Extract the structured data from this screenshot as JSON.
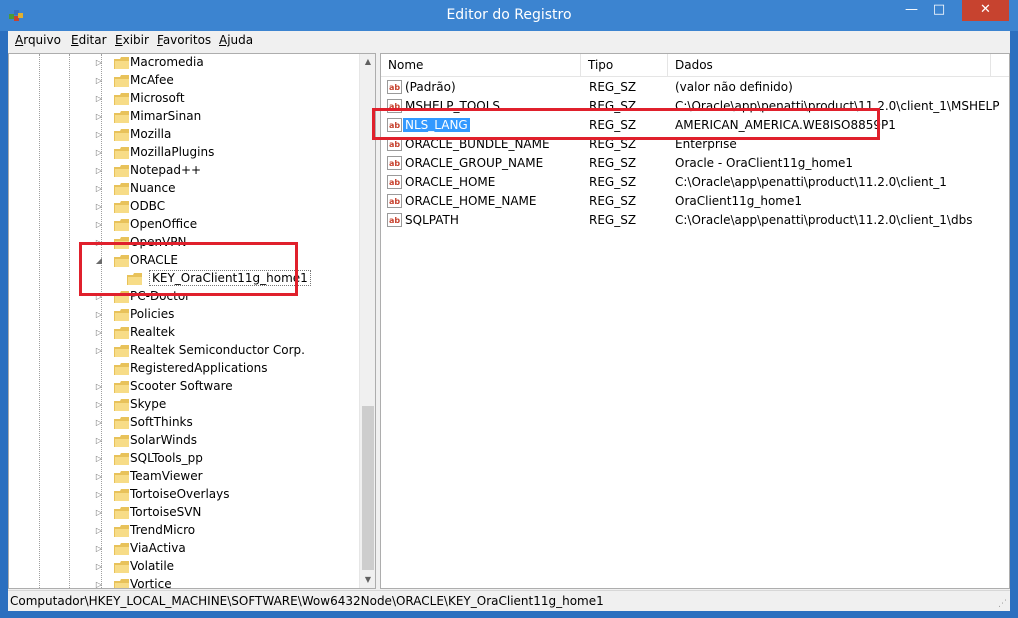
{
  "window": {
    "title": "Editor do Registro",
    "min_glyph": "—",
    "max_glyph": "□",
    "close_glyph": "✕"
  },
  "menu": [
    {
      "mnemonic": "A",
      "rest": "rquivo"
    },
    {
      "mnemonic": "E",
      "rest": "ditar"
    },
    {
      "mnemonic": "E",
      "rest": "xibir"
    },
    {
      "mnemonic": "F",
      "rest": "avoritos"
    },
    {
      "mnemonic": "Aj",
      "rest": "uda"
    }
  ],
  "tree": {
    "items": [
      {
        "label": "Macromedia",
        "expander": "▷"
      },
      {
        "label": "McAfee",
        "expander": "▷"
      },
      {
        "label": "Microsoft",
        "expander": "▷"
      },
      {
        "label": "MimarSinan",
        "expander": "▷"
      },
      {
        "label": "Mozilla",
        "expander": "▷"
      },
      {
        "label": "MozillaPlugins",
        "expander": "▷"
      },
      {
        "label": "Notepad++",
        "expander": "▷"
      },
      {
        "label": "Nuance",
        "expander": "▷"
      },
      {
        "label": "ODBC",
        "expander": "▷"
      },
      {
        "label": "OpenOffice",
        "expander": "▷"
      },
      {
        "label": "OpenVPN",
        "expander": "▷"
      },
      {
        "label": "ORACLE",
        "expander": "◢"
      },
      {
        "label": "KEY_OraClient11g_home1",
        "expander": ""
      },
      {
        "label": "PC-Doctor",
        "expander": "▷"
      },
      {
        "label": "Policies",
        "expander": "▷"
      },
      {
        "label": "Realtek",
        "expander": "▷"
      },
      {
        "label": "Realtek Semiconductor Corp.",
        "expander": "▷"
      },
      {
        "label": "RegisteredApplications",
        "expander": ""
      },
      {
        "label": "Scooter Software",
        "expander": "▷"
      },
      {
        "label": "Skype",
        "expander": "▷"
      },
      {
        "label": "SoftThinks",
        "expander": "▷"
      },
      {
        "label": "SolarWinds",
        "expander": "▷"
      },
      {
        "label": "SQLTools_pp",
        "expander": "▷"
      },
      {
        "label": "TeamViewer",
        "expander": "▷"
      },
      {
        "label": "TortoiseOverlays",
        "expander": "▷"
      },
      {
        "label": "TortoiseSVN",
        "expander": "▷"
      },
      {
        "label": "TrendMicro",
        "expander": "▷"
      },
      {
        "label": "ViaActiva",
        "expander": "▷"
      },
      {
        "label": "Volatile",
        "expander": "▷"
      },
      {
        "label": "Vortice",
        "expander": "▷"
      }
    ],
    "scroll_up": "▲",
    "scroll_down": "▼"
  },
  "list": {
    "headers": [
      "Nome",
      "Tipo",
      "Dados"
    ],
    "rows": [
      {
        "name": "(Padrão)",
        "type": "REG_SZ",
        "data": "(valor não definido)"
      },
      {
        "name": "MSHELP_TOOLS",
        "type": "REG_SZ",
        "data": "C:\\Oracle\\app\\penatti\\product\\11.2.0\\client_1\\MSHELP"
      },
      {
        "name": "NLS_LANG",
        "type": "REG_SZ",
        "data": "AMERICAN_AMERICA.WE8ISO8859P1"
      },
      {
        "name": "ORACLE_BUNDLE_NAME",
        "type": "REG_SZ",
        "data": "Enterprise"
      },
      {
        "name": "ORACLE_GROUP_NAME",
        "type": "REG_SZ",
        "data": "Oracle - OraClient11g_home1"
      },
      {
        "name": "ORACLE_HOME",
        "type": "REG_SZ",
        "data": "C:\\Oracle\\app\\penatti\\product\\11.2.0\\client_1"
      },
      {
        "name": "ORACLE_HOME_NAME",
        "type": "REG_SZ",
        "data": "OraClient11g_home1"
      },
      {
        "name": "SQLPATH",
        "type": "REG_SZ",
        "data": "C:\\Oracle\\app\\penatti\\product\\11.2.0\\client_1\\dbs"
      }
    ]
  },
  "status": {
    "path": "Computador\\HKEY_LOCAL_MACHINE\\SOFTWARE\\Wow6432Node\\ORACLE\\KEY_OraClient11g_home1"
  },
  "colors": {
    "selection": "#3399ff",
    "highlight": "#e0202c",
    "titlebar": "#3c84d0"
  }
}
